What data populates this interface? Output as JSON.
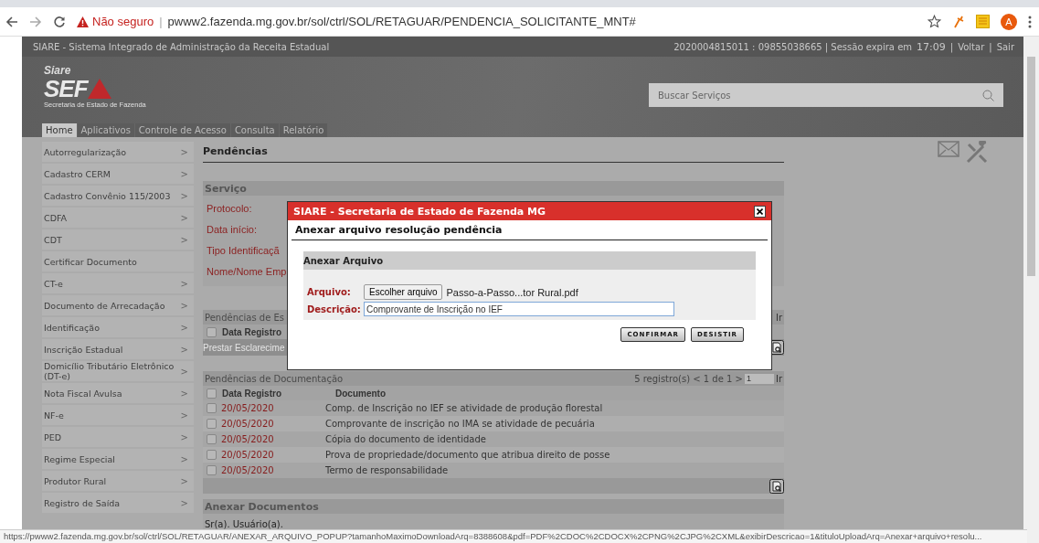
{
  "browser": {
    "security": "Não seguro",
    "separator": "|",
    "url": "pwww2.fazenda.mg.gov.br/sol/ctrl/SOL/RETAGUAR/PENDENCIA_SOLICITANTE_MNT#",
    "profile": "A"
  },
  "header": {
    "system_name": "SIARE - Sistema Integrado de Administração da Receita Estadual",
    "session": "2020004815011 : 09855038665 | Sessão expira em",
    "time": "17:09",
    "separator": "|",
    "links": [
      "Voltar",
      "Sair"
    ],
    "logo": {
      "top": "Siare",
      "main": "SEF",
      "caption": "Secretaria de Estado de Fazenda"
    },
    "search": {
      "placeholder": "Buscar Serviços"
    }
  },
  "nav": [
    {
      "label": "Home",
      "selected": true
    },
    {
      "label": "Aplicativos",
      "selected": false
    },
    {
      "label": "Controle de Acesso",
      "selected": false
    },
    {
      "label": "Consulta",
      "selected": false
    },
    {
      "label": "Relatório",
      "selected": false
    }
  ],
  "sidebar": [
    {
      "label": "Autorregularização",
      "chevron": ">"
    },
    {
      "label": "Cadastro CERM",
      "chevron": ">"
    },
    {
      "label": "Cadastro Convênio 115/2003",
      "chevron": ">"
    },
    {
      "label": "CDFA",
      "chevron": ">"
    },
    {
      "label": "CDT",
      "chevron": ">"
    },
    {
      "label": "Certificar Documento"
    },
    {
      "label": "CT-e",
      "chevron": ">"
    },
    {
      "label": "Documento de Arrecadação",
      "chevron": ">"
    },
    {
      "label": "Identificação",
      "chevron": ">"
    },
    {
      "label": "Inscrição Estadual",
      "chevron": ">"
    },
    {
      "label": "Domicílio Tributário Eletrônico (DT-e)",
      "chevron": ">"
    },
    {
      "label": "Nota Fiscal Avulsa",
      "chevron": ">"
    },
    {
      "label": "NF-e",
      "chevron": ">"
    },
    {
      "label": "PED",
      "chevron": ">"
    },
    {
      "label": "Regime Especial",
      "chevron": ">"
    },
    {
      "label": "Produtor Rural",
      "chevron": ">"
    },
    {
      "label": "Registro de Saída",
      "chevron": ">"
    }
  ],
  "page": {
    "title": "Pendências",
    "service": {
      "title": "Serviço",
      "fields": [
        "Protocolo:",
        "Data início:",
        "Tipo Identificaçã",
        "Nome/Nome Emp"
      ]
    },
    "clarifications": {
      "title": "Pendências de Es",
      "column": "Data Registro",
      "checked": false,
      "action": "Prestar Esclarecime",
      "go": "Ir"
    },
    "documents": {
      "title": "Pendências de Documentação",
      "pager": "5 registro(s) < 1 de 1 >",
      "page": "1",
      "go": "Ir",
      "checked": false,
      "columns": [
        "Data Registro",
        "Documento"
      ],
      "rows": [
        {
          "date": "20/05/2020",
          "document": "Comp. de Inscrição no IEF se atividade de produção florestal",
          "checked": false
        },
        {
          "date": "20/05/2020",
          "document": "Comprovante de inscrição no IMA se atividade de pecuária",
          "checked": false
        },
        {
          "date": "20/05/2020",
          "document": "Cópia do documento de identidade",
          "checked": false
        },
        {
          "date": "20/05/2020",
          "document": "Prova de propriedade/documento que atribua direito de posse",
          "checked": false
        },
        {
          "date": "20/05/2020",
          "document": "Termo de responsabilidade",
          "checked": false
        }
      ]
    },
    "attach": {
      "title": "Anexar Documentos",
      "text": "Sr(a). Usuário(a)."
    }
  },
  "modal": {
    "title": "SIARE - Secretaria de Estado de Fazenda MG",
    "subtitle": "Anexar arquivo resolução pendência",
    "section": "Anexar Arquivo",
    "file_label": "Arquivo:",
    "file_button": "Escolher arquivo",
    "file_name": "Passo-a-Passo...tor Rural.pdf",
    "description_label": "Descrição:",
    "description": "Comprovante de Inscrição no IEF",
    "buttons": [
      "CONFIRMAR",
      "DESISTIR"
    ]
  },
  "status_url": "https://pwww2.fazenda.mg.gov.br/sol/ctrl/SOL/RETAGUAR/ANEXAR_ARQUIVO_POPUP?tamanhoMaximoDownloadArq=8388608&pdf=PDF%2CDOC%2CDOCX%2CPNG%2CJPG%2CXML&exibirDescricao=1&tituloUploadArq=Anexar+arquivo+resolu..."
}
